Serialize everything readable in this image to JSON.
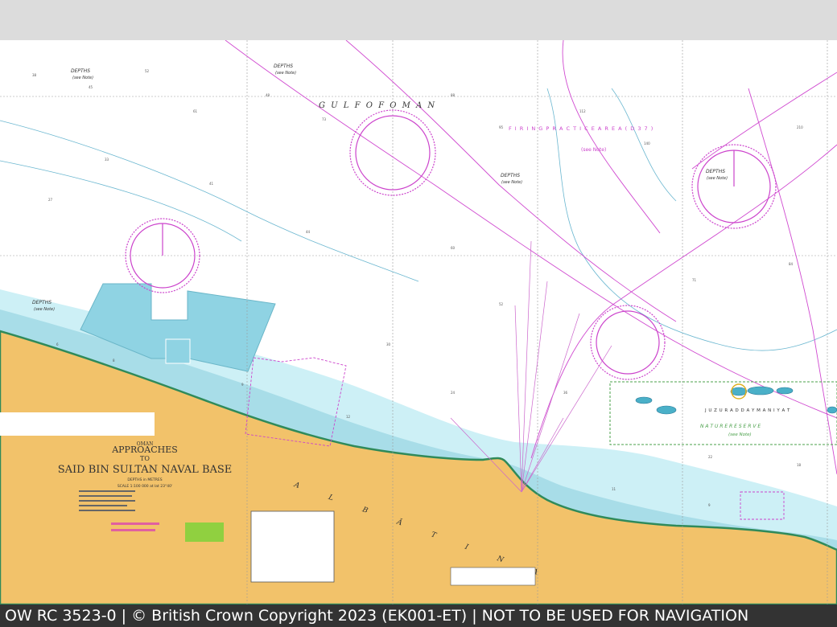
{
  "header": {},
  "chart_title": {
    "country": "OMAN",
    "line1": "APPROACHES",
    "line2": "TO",
    "line3": "SAID BIN SULTAN NAVAL BASE",
    "depths_note": "DEPTHS in METRES",
    "scale": "SCALE 1:100 000 at lat 23°40'"
  },
  "sea_labels": {
    "gulf": "G U L F   O F   O M A N",
    "firing_area": "F I R I N G   P R A C T I C E   A R E A   ( D 3 7 )",
    "see_note": "(see Note)",
    "depths": "DEPTHS",
    "depths_note": "(see Note)",
    "islands": "J U Z U R   A D   D A Y M A N I Y A T",
    "nature_reserve": "N A T U R E   R E S E R V E",
    "al_batina": "A L   B Ā T I N A"
  },
  "colors": {
    "land": "#f2c26a",
    "shallow": "#a8dde8",
    "mid": "#cdf0f6",
    "deep": "#ffffff",
    "magenta": "#cc33cc",
    "reef": "#3a9a6a"
  },
  "footer": {
    "text": "OW RC 3523-0 | © British Crown Copyright 2023 (EK001-ET) | NOT TO BE USED FOR NAVIGATION"
  }
}
